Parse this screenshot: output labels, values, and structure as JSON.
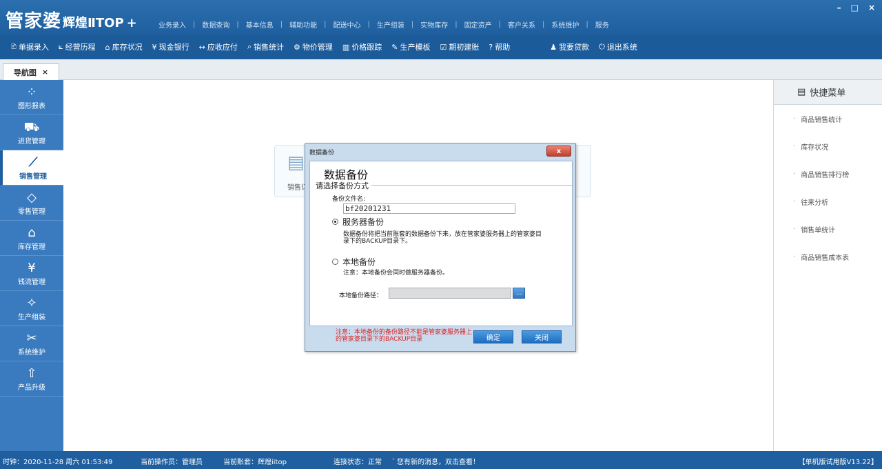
{
  "app": {
    "brand": "管家婆",
    "edition": "辉煌ⅡTOP",
    "plus": "+"
  },
  "top_menu": [
    "业务录入",
    "数据查询",
    "基本信息",
    "辅助功能",
    "配送中心",
    "生产组装",
    "实物库存",
    "固定资产",
    "客户关系",
    "系统维护",
    "服务"
  ],
  "window_controls": {
    "minimize": "–",
    "maximize": "□",
    "close": "×"
  },
  "toolbar": [
    {
      "icon": "🗈",
      "label": "单据录入"
    },
    {
      "icon": "⟀",
      "label": "经营历程"
    },
    {
      "icon": "⌂",
      "label": "库存状况"
    },
    {
      "icon": "¥",
      "label": "现金银行"
    },
    {
      "icon": "↔",
      "label": "应收应付"
    },
    {
      "icon": "⌕",
      "label": "销售统计"
    },
    {
      "icon": "⚙",
      "label": "物价管理"
    },
    {
      "icon": "▥",
      "label": "价格跟踪"
    },
    {
      "icon": "✎",
      "label": "生产模板"
    },
    {
      "icon": "☑",
      "label": "期初建账"
    },
    {
      "icon": "?",
      "label": "帮助"
    },
    {
      "icon": "♟",
      "label": "我要贷款"
    },
    {
      "icon": "⏻",
      "label": "退出系统"
    }
  ],
  "tab": {
    "label": "导航图",
    "close": "×"
  },
  "sidebar": [
    {
      "icon": "⁘",
      "label": "图形报表",
      "active": false
    },
    {
      "icon": "⛟",
      "label": "进货管理",
      "active": false
    },
    {
      "icon": "⟋",
      "label": "销售管理",
      "active": true
    },
    {
      "icon": "◇",
      "label": "零售管理",
      "active": false
    },
    {
      "icon": "⌂",
      "label": "库存管理",
      "active": false
    },
    {
      "icon": "¥",
      "label": "钱流管理",
      "active": false
    },
    {
      "icon": "✧",
      "label": "生产组装",
      "active": false
    },
    {
      "icon": "✂",
      "label": "系统维护",
      "active": false
    },
    {
      "icon": "⇧",
      "label": "产品升级",
      "active": false
    }
  ],
  "main": {
    "card_label": "销售订"
  },
  "right_panel": {
    "title": "快捷菜单",
    "items": [
      "商品销售统计",
      "库存状况",
      "商品销售排行榜",
      "往来分析",
      "销售单统计",
      "商品销售成本表"
    ]
  },
  "dialog": {
    "title": "数据备份",
    "close_label": "x",
    "heading": "数据备份",
    "group_label": "请选择备份方式",
    "filename_label": "备份文件名:",
    "filename_value": "bf20201231",
    "option_server": "服务器备份",
    "option_server_selected": true,
    "server_desc": "数据备份将把当前账套的数据备份下来，放在管家婆服务器上的管家婆目录下的BACKUP目录下。",
    "option_local": "本地备份",
    "option_local_selected": false,
    "local_desc": "注意：本地备份会同时做服务器备份。",
    "local_path_label": "本地备份路径：",
    "local_path_value": "",
    "browse_label": "...",
    "footer_note": "注意：本地备份的备份路径不能是管家婆服务器上的管家婆目录下的BACKUP目录",
    "ok_label": "确定",
    "close_button_label": "关闭"
  },
  "status": {
    "clock": "时钟：2020-11-28 周六 01:53:49",
    "operator": "当前操作员：管理员",
    "account": "当前账套：辉煌iitop",
    "connection": "连接状态：正常",
    "message": "您有新的消息，双击查看！",
    "version": "【单机版试用版V13.22】"
  }
}
